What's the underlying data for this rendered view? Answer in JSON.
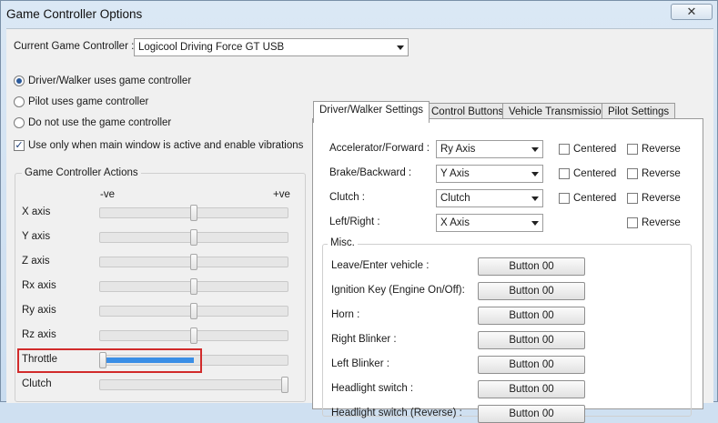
{
  "window": {
    "title": "Game Controller Options",
    "close_glyph": "✕"
  },
  "current_controller": {
    "label": "Current Game Controller :",
    "value": "Logicool Driving Force GT USB"
  },
  "modes": {
    "driver_walker": "Driver/Walker uses game controller",
    "pilot": "Pilot uses game controller",
    "none": "Do not use the game controller",
    "selected": "driver_walker"
  },
  "vibration": {
    "label": "Use only when main window is active and enable vibrations",
    "checked": true
  },
  "actions": {
    "group_label": "Game Controller Actions",
    "neg_label": "-ve",
    "pos_label": "+ve",
    "axes": [
      {
        "label": "X axis",
        "level": 0.5
      },
      {
        "label": "Y axis",
        "level": 0.5
      },
      {
        "label": "Z axis",
        "level": 0.5
      },
      {
        "label": "Rx axis",
        "level": 0.5
      },
      {
        "label": "Ry axis",
        "level": 0.5
      },
      {
        "label": "Rz axis",
        "level": 0.5
      },
      {
        "label": "Throttle",
        "level": 0.0
      },
      {
        "label": "Clutch",
        "level": 1.0
      }
    ],
    "throttle_progress": 0.46
  },
  "tabs": [
    "Driver/Walker Settings",
    "Control Buttons",
    "Vehicle Transmission",
    "Pilot Settings"
  ],
  "driver_settings": {
    "centered_label": "Centered",
    "reverse_label": "Reverse",
    "rows": [
      {
        "label": "Accelerator/Forward :",
        "value": "Ry Axis",
        "has_centered": true
      },
      {
        "label": "Brake/Backward :",
        "value": "Y Axis",
        "has_centered": true
      },
      {
        "label": "Clutch :",
        "value": "Clutch",
        "has_centered": true
      },
      {
        "label": "Left/Right :",
        "value": "X Axis",
        "has_centered": false
      }
    ]
  },
  "misc": {
    "group_label": "Misc.",
    "items": [
      {
        "label": "Leave/Enter vehicle :",
        "button": "Button 00"
      },
      {
        "label": "Ignition Key (Engine On/Off):",
        "button": "Button 00"
      },
      {
        "label": "Horn :",
        "button": "Button 00"
      },
      {
        "label": "Right Blinker :",
        "button": "Button 00"
      },
      {
        "label": "Left Blinker :",
        "button": "Button 00"
      },
      {
        "label": "Headlight switch :",
        "button": "Button 00"
      },
      {
        "label": "Headlight switch (Reverse) :",
        "button": "Button 00"
      }
    ]
  }
}
